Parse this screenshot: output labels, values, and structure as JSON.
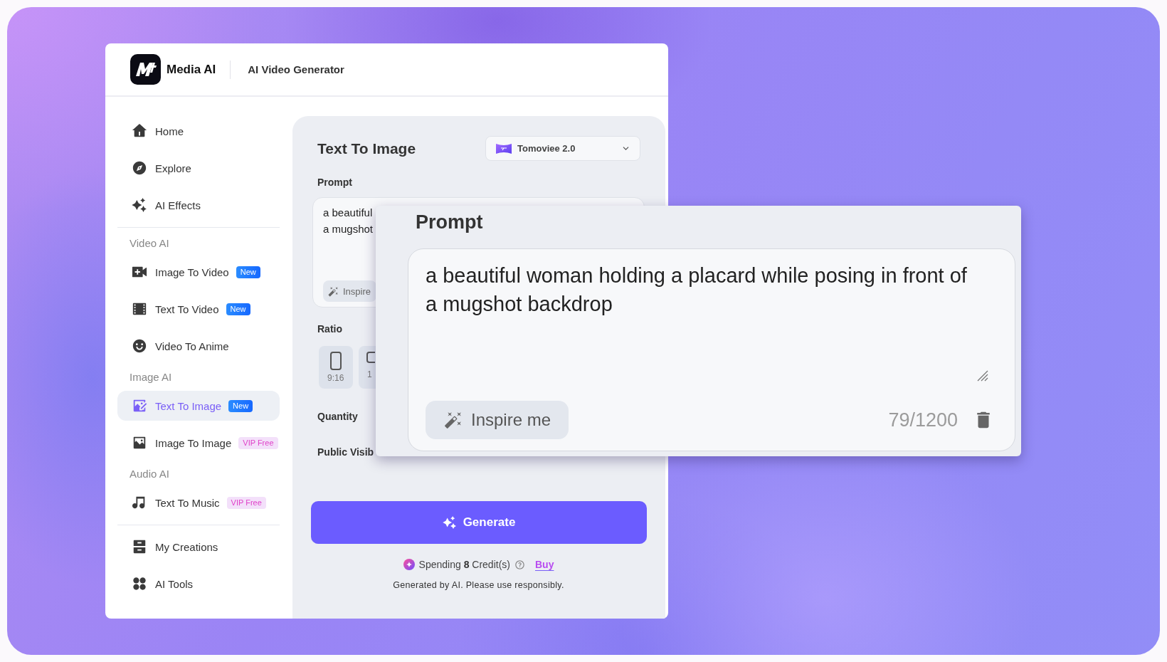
{
  "header": {
    "brand": "Media AI",
    "title": "AI Video Generator"
  },
  "sidebar": {
    "primary": [
      {
        "label": "Home",
        "selected": false
      },
      {
        "label": "Explore",
        "selected": false
      },
      {
        "label": "AI Effects",
        "selected": false
      }
    ],
    "categories": [
      {
        "heading": "Video AI",
        "items": [
          {
            "label": "Image To Video",
            "selected": false,
            "badge": {
              "text": "New",
              "kind": "new"
            }
          },
          {
            "label": "Text To Video",
            "selected": false,
            "badge": {
              "text": "New",
              "kind": "new"
            }
          },
          {
            "label": "Video To Anime",
            "selected": false
          }
        ]
      },
      {
        "heading": "Image AI",
        "items": [
          {
            "label": "Text To Image",
            "selected": true,
            "badge": {
              "text": "New",
              "kind": "new"
            }
          },
          {
            "label": "Image To Image",
            "selected": false,
            "badge": {
              "text": "VIP Free",
              "kind": "vip"
            }
          }
        ]
      },
      {
        "heading": "Audio AI",
        "items": [
          {
            "label": "Text To Music",
            "selected": false,
            "badge": {
              "text": "VIP Free",
              "kind": "vip"
            }
          }
        ]
      }
    ],
    "secondary": [
      {
        "label": "My Creations",
        "selected": false
      },
      {
        "label": "AI Tools",
        "selected": false
      }
    ]
  },
  "generator": {
    "title": "Text To Image",
    "model": {
      "name": "Tomoviee 2.0"
    },
    "prompt": {
      "label": "Prompt",
      "value_lines": [
        "a beautiful",
        "a mugshot"
      ],
      "inspire_button": "Inspire"
    },
    "ratio": {
      "label": "Ratio",
      "options": [
        {
          "label": "9:16"
        },
        {
          "label": "1"
        }
      ]
    },
    "quantity": {
      "label": "Quantity"
    },
    "public_visibility": {
      "label": "Public Visib"
    },
    "generate_button": "Generate",
    "credits": {
      "text": "Spending **8** Credit(s)",
      "link": "Buy"
    },
    "disclaimer": "Generated by AI. Please use responsibly."
  },
  "prompt_zoom": {
    "label": "Prompt",
    "value": "a beautiful woman holding a placard while posing in front of a mugshot backdrop",
    "inspire_button": "Inspire me",
    "counter": "79/1200"
  }
}
